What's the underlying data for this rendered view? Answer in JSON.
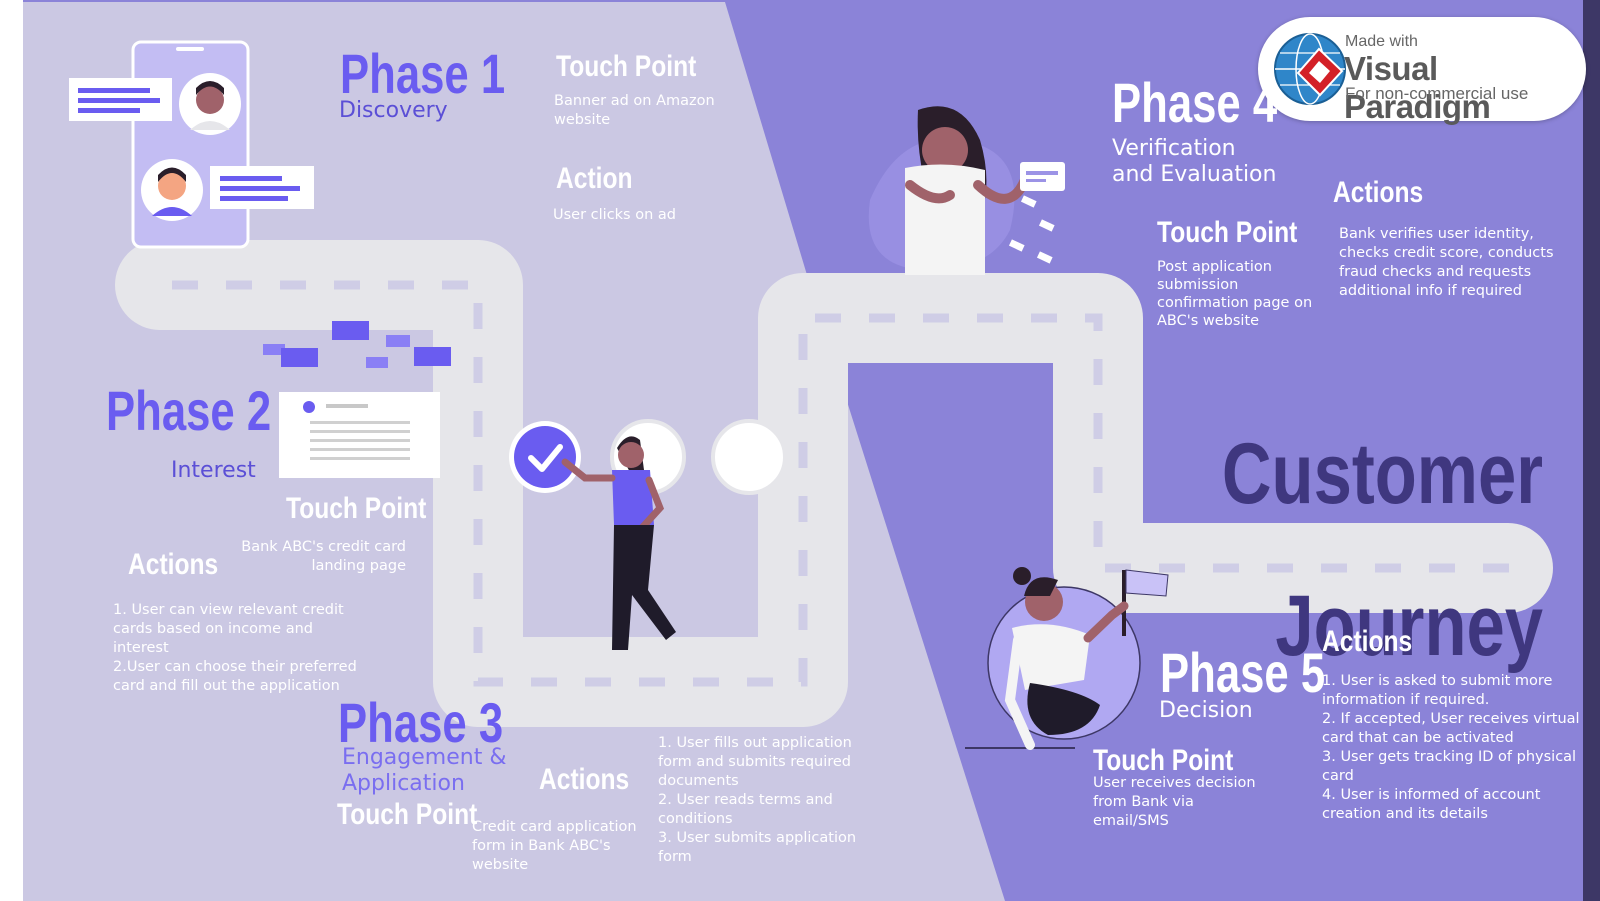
{
  "title": {
    "line1": "Customer",
    "line2": "Journey"
  },
  "watermark": {
    "line1": "Made with",
    "line2": "Visual Paradigm",
    "line3": "For non-commercial use"
  },
  "edge_text": "Ac",
  "phase1": {
    "label": "Phase 1",
    "name": "Discovery",
    "touch_point_heading": "Touch Point",
    "touch_point": "Banner ad on Amazon\nwebsite",
    "action_heading": "Action",
    "action": "User clicks on ad"
  },
  "phase2": {
    "label": "Phase 2",
    "name": "Interest",
    "touch_point_heading": "Touch Point",
    "touch_point": "Bank ABC's credit card\nlanding page",
    "actions_heading": "Actions",
    "actions": "1. User can view relevant credit\ncards based on income and\ninterest\n2.User can choose their preferred\ncard and fill out the application"
  },
  "phase3": {
    "label": "Phase 3",
    "name": "Engagement &\nApplication",
    "touch_point_heading": "Touch Point",
    "touch_point": "Credit card application\nform in Bank ABC's\nwebsite",
    "actions_heading": "Actions",
    "actions": "1. User fills out application\nform and submits required\ndocuments\n2. User reads terms and\nconditions\n3. User submits application\nform"
  },
  "phase4": {
    "label": "Phase 4",
    "name": "Verification\nand Evaluation",
    "touch_point_heading": "Touch Point",
    "touch_point": "Post application\nsubmission\nconfirmation page on\nABC's website",
    "actions_heading": "Actions",
    "actions": "Bank verifies user identity,\nchecks credit score, conducts\nfraud checks and requests\nadditional info if required"
  },
  "phase5": {
    "label": "Phase 5",
    "name": "Decision",
    "touch_point_heading": "Touch Point",
    "touch_point": "User receives decision\nfrom Bank via\nemail/SMS",
    "actions_heading": "Actions",
    "actions": "1. User is asked to submit more\ninformation if required.\n2. If accepted, User receives virtual\ncard that can be activated\n3. User gets tracking ID of physical\ncard\n4. User is informed of account\ncreation and its details"
  },
  "colors": {
    "light_panel": "#cbc8e3",
    "dark_panel": "#8b83d8",
    "road": "#e6e6ea",
    "accent": "#6a5cf0",
    "title": "#3f377f"
  }
}
